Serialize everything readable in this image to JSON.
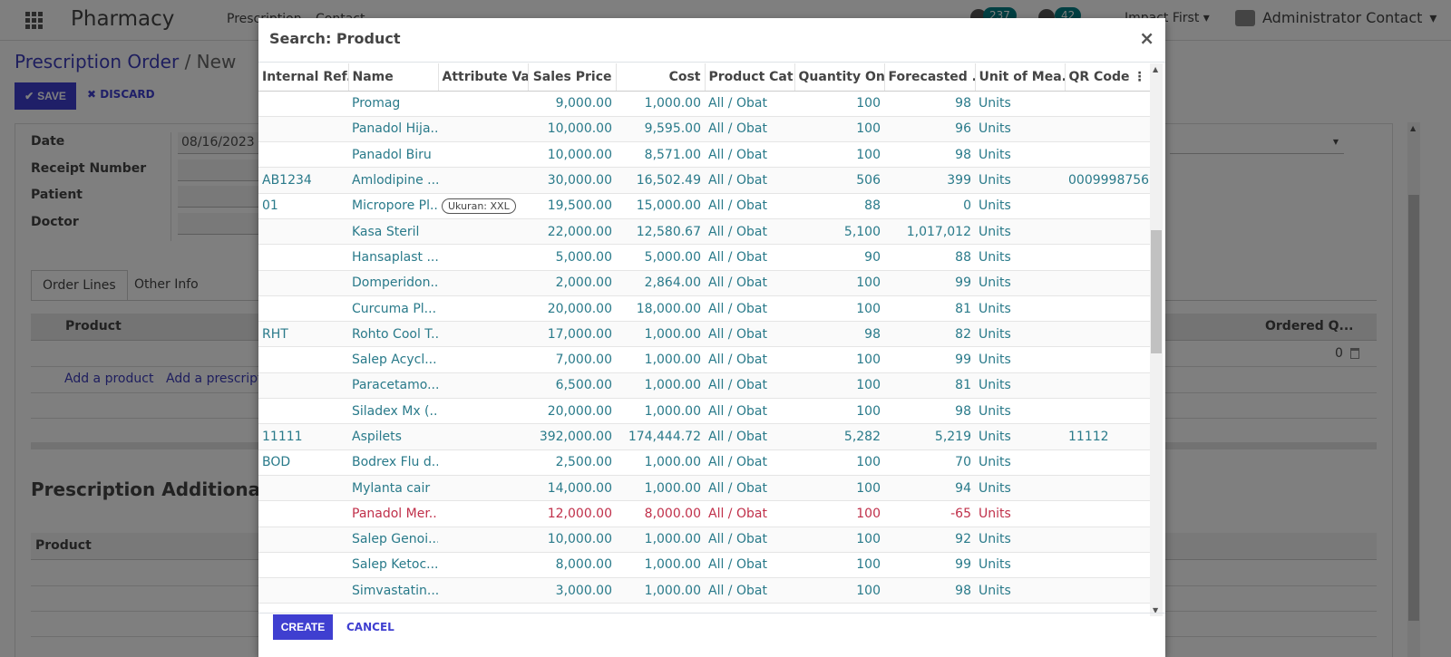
{
  "app": {
    "brand": "Pharmacy",
    "menu": [
      "Prescription",
      "Contact"
    ],
    "activity_count": "237",
    "message_count": "42",
    "company": "Impact First",
    "user": "Administrator Contact"
  },
  "breadcrumb": {
    "parent": "Prescription Order",
    "separator": "/",
    "current": "New"
  },
  "actions": {
    "save": "SAVE",
    "discard": "DISCARD"
  },
  "form": {
    "date_label": "Date",
    "date_value": "08/16/2023",
    "receipt_label": "Receipt Number",
    "patient_label": "Patient",
    "doctor_label": "Doctor"
  },
  "tabs": [
    "Order Lines",
    "Other Info"
  ],
  "order_lines": {
    "col_product": "Product",
    "col_ordered": "Ordered Q...",
    "add_product": "Add a product",
    "add_prescription": "Add a prescript",
    "zero_value": "0"
  },
  "additional": {
    "title": "Prescription Additional In",
    "col_product": "Product"
  },
  "modal": {
    "title": "Search: Product",
    "close": "×",
    "columns": [
      "Internal Ref...",
      "Name",
      "Attribute Va...",
      "Sales Price",
      "Cost",
      "Product Cat...",
      "Quantity On...",
      "Forecasted ...",
      "Unit of Mea...",
      "QR Code"
    ],
    "rows": [
      {
        "ref": "",
        "name": "Promag",
        "attr": "",
        "price": "9,000.00",
        "cost": "1,000.00",
        "cat": "All / Obat",
        "qty": "100",
        "forecast": "98",
        "uom": "Units",
        "qr": "",
        "danger": false
      },
      {
        "ref": "",
        "name": "Panadol Hija...",
        "attr": "",
        "price": "10,000.00",
        "cost": "9,595.00",
        "cat": "All / Obat",
        "qty": "100",
        "forecast": "96",
        "uom": "Units",
        "qr": "",
        "danger": false
      },
      {
        "ref": "",
        "name": "Panadol Biru",
        "attr": "",
        "price": "10,000.00",
        "cost": "8,571.00",
        "cat": "All / Obat",
        "qty": "100",
        "forecast": "98",
        "uom": "Units",
        "qr": "",
        "danger": false
      },
      {
        "ref": "AB1234",
        "name": "Amlodipine ...",
        "attr": "",
        "price": "30,000.00",
        "cost": "16,502.49",
        "cat": "All / Obat",
        "qty": "506",
        "forecast": "399",
        "uom": "Units",
        "qr": "0009998756",
        "danger": false
      },
      {
        "ref": "01",
        "name": "Micropore Pl...",
        "attr": "Ukuran: XXL",
        "price": "19,500.00",
        "cost": "15,000.00",
        "cat": "All / Obat",
        "qty": "88",
        "forecast": "0",
        "uom": "Units",
        "qr": "",
        "danger": false
      },
      {
        "ref": "",
        "name": "Kasa Steril",
        "attr": "",
        "price": "22,000.00",
        "cost": "12,580.67",
        "cat": "All / Obat",
        "qty": "5,100",
        "forecast": "1,017,012",
        "uom": "Units",
        "qr": "",
        "danger": false
      },
      {
        "ref": "",
        "name": "Hansaplast ...",
        "attr": "",
        "price": "5,000.00",
        "cost": "5,000.00",
        "cat": "All / Obat",
        "qty": "90",
        "forecast": "88",
        "uom": "Units",
        "qr": "",
        "danger": false
      },
      {
        "ref": "",
        "name": "Domperidon...",
        "attr": "",
        "price": "2,000.00",
        "cost": "2,864.00",
        "cat": "All / Obat",
        "qty": "100",
        "forecast": "99",
        "uom": "Units",
        "qr": "",
        "danger": false
      },
      {
        "ref": "",
        "name": "Curcuma Pl...",
        "attr": "",
        "price": "20,000.00",
        "cost": "18,000.00",
        "cat": "All / Obat",
        "qty": "100",
        "forecast": "81",
        "uom": "Units",
        "qr": "",
        "danger": false
      },
      {
        "ref": "RHT",
        "name": "Rohto Cool T...",
        "attr": "",
        "price": "17,000.00",
        "cost": "1,000.00",
        "cat": "All / Obat",
        "qty": "98",
        "forecast": "82",
        "uom": "Units",
        "qr": "",
        "danger": false
      },
      {
        "ref": "",
        "name": "Salep Acycl...",
        "attr": "",
        "price": "7,000.00",
        "cost": "1,000.00",
        "cat": "All / Obat",
        "qty": "100",
        "forecast": "99",
        "uom": "Units",
        "qr": "",
        "danger": false
      },
      {
        "ref": "",
        "name": "Paracetamo...",
        "attr": "",
        "price": "6,500.00",
        "cost": "1,000.00",
        "cat": "All / Obat",
        "qty": "100",
        "forecast": "81",
        "uom": "Units",
        "qr": "",
        "danger": false
      },
      {
        "ref": "",
        "name": "Siladex Mx (...",
        "attr": "",
        "price": "20,000.00",
        "cost": "1,000.00",
        "cat": "All / Obat",
        "qty": "100",
        "forecast": "98",
        "uom": "Units",
        "qr": "",
        "danger": false
      },
      {
        "ref": "11111",
        "name": "Aspilets",
        "attr": "",
        "price": "392,000.00",
        "cost": "174,444.72",
        "cat": "All / Obat",
        "qty": "5,282",
        "forecast": "5,219",
        "uom": "Units",
        "qr": "11112",
        "danger": false
      },
      {
        "ref": "BOD",
        "name": "Bodrex Flu d...",
        "attr": "",
        "price": "2,500.00",
        "cost": "1,000.00",
        "cat": "All / Obat",
        "qty": "100",
        "forecast": "70",
        "uom": "Units",
        "qr": "",
        "danger": false
      },
      {
        "ref": "",
        "name": "Mylanta cair",
        "attr": "",
        "price": "14,000.00",
        "cost": "1,000.00",
        "cat": "All / Obat",
        "qty": "100",
        "forecast": "94",
        "uom": "Units",
        "qr": "",
        "danger": false
      },
      {
        "ref": "",
        "name": "Panadol Mer...",
        "attr": "",
        "price": "12,000.00",
        "cost": "8,000.00",
        "cat": "All / Obat",
        "qty": "100",
        "forecast": "-65",
        "uom": "Units",
        "qr": "",
        "danger": true
      },
      {
        "ref": "",
        "name": "Salep Genoi...",
        "attr": "",
        "price": "10,000.00",
        "cost": "1,000.00",
        "cat": "All / Obat",
        "qty": "100",
        "forecast": "92",
        "uom": "Units",
        "qr": "",
        "danger": false
      },
      {
        "ref": "",
        "name": "Salep Ketoc...",
        "attr": "",
        "price": "8,000.00",
        "cost": "1,000.00",
        "cat": "All / Obat",
        "qty": "100",
        "forecast": "99",
        "uom": "Units",
        "qr": "",
        "danger": false
      },
      {
        "ref": "",
        "name": "Simvastatin...",
        "attr": "",
        "price": "3,000.00",
        "cost": "1,000.00",
        "cat": "All / Obat",
        "qty": "100",
        "forecast": "98",
        "uom": "Units",
        "qr": "",
        "danger": false
      }
    ],
    "create": "CREATE",
    "cancel": "CANCEL"
  },
  "colors": {
    "primary": "#3f3fd0",
    "link": "#297a8a",
    "danger": "#c0304a",
    "badge": "#017e84"
  }
}
